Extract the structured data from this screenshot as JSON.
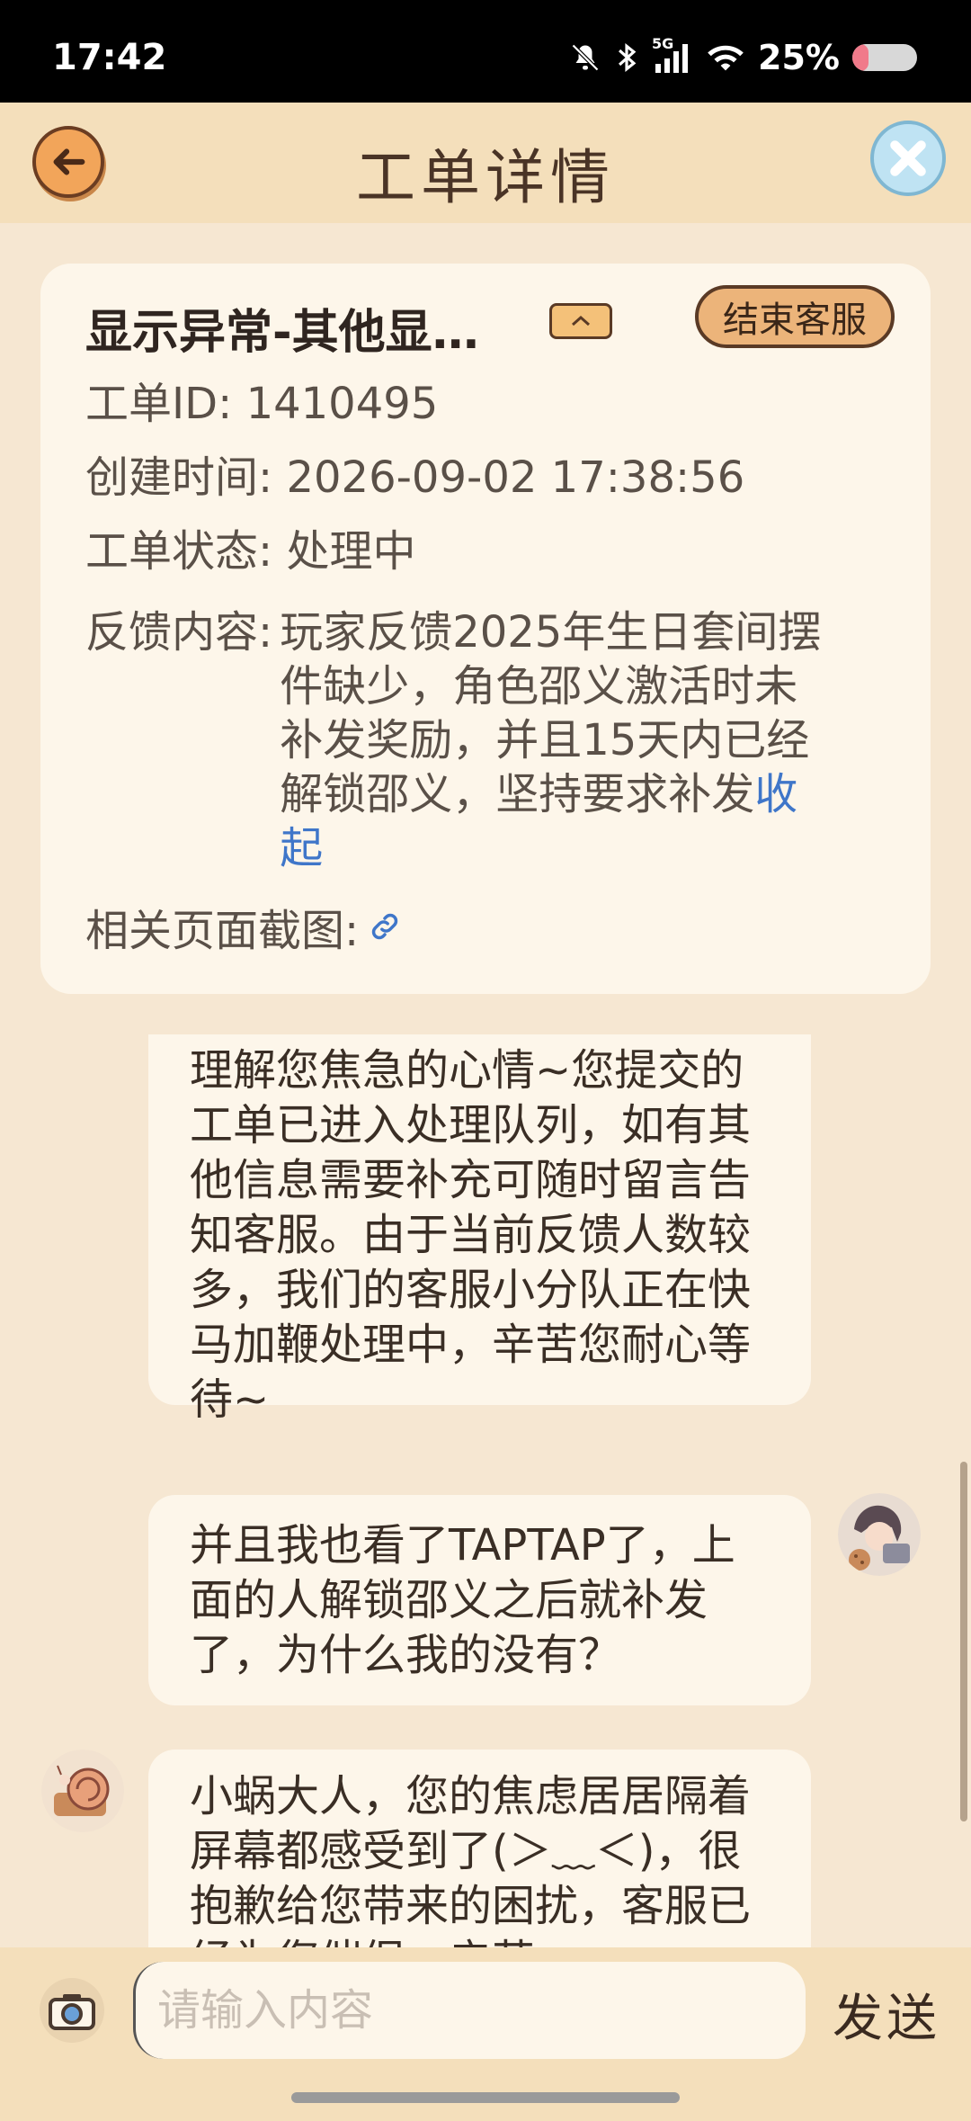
{
  "status_bar": {
    "time": "17:42",
    "network": "5G",
    "battery_percent": "25%",
    "battery_level": 0.25,
    "icons": [
      "mute-bell-icon",
      "bluetooth-icon",
      "signal-icon",
      "wifi-icon",
      "battery-icon"
    ]
  },
  "header": {
    "title": "工单详情",
    "back_icon": "back-arrow-icon",
    "close_icon": "close-icon"
  },
  "ticket": {
    "title": "显示异常-其他显…",
    "end_service_label": "结束客服",
    "id_label": "工单ID:",
    "id_value": "1410495",
    "created_label": "创建时间:",
    "created_value": "2026-09-02 17:38:56",
    "status_label": "工单状态:",
    "status_value": "处理中",
    "feedback_label": "反馈内容:",
    "feedback_value": "玩家反馈2025年生日套间摆件缺少，角色邵义激活时未补发奖励，并且15天内已经解锁邵义，坚持要求补发",
    "collapse_label": "收起",
    "screenshot_label": "相关页面截图:"
  },
  "chat": {
    "messages": [
      {
        "sender": "service",
        "text": "理解您焦急的心情~您提交的工单已进入处理队列，如有其他信息需要补充可随时留言告知客服。由于当前反馈人数较多，我们的客服小分队正在快马加鞭处理中，辛苦您耐心等待~"
      },
      {
        "sender": "user",
        "text": "并且我也看了TAPTAP了，上面的人解锁邵义之后就补发了，为什么我的没有？"
      },
      {
        "sender": "service",
        "text": "小蜗大人，您的焦虑居居隔着屏幕都感受到了(＞﹏＜)，很抱歉给您带来的困扰，客服已经为您催促，辛苦"
      }
    ]
  },
  "input_bar": {
    "placeholder": "请输入内容",
    "send_label": "发送",
    "camera_icon": "camera-icon"
  },
  "colors": {
    "background": "#f6e7d2",
    "header": "#f4dfbb",
    "card": "#fdf6ea",
    "link": "#3f76c9",
    "accent_button": "#ecb47a"
  }
}
